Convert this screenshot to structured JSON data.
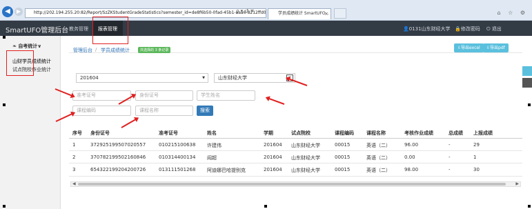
{
  "browser": {
    "url": "http://202.194.255.20:82/Report/SzZKStudentGradeStatistics?semester_id=de8f6b50-0fad-45b1-aaa6-8212ffd0(",
    "url_icons": "ρ ▾ ↺ ✕",
    "tab_title": "学员成绩统计 SmartUFO...",
    "tab_close": "×",
    "window_icons": "⌂ ☆ ⚙"
  },
  "header": {
    "brand": "SmartUFO管理后台",
    "nav": [
      "教务管理",
      "报表管理"
    ],
    "user": "0131山东财经大学",
    "change_password": "修改密码",
    "logout": "退出"
  },
  "sidebar": {
    "group": "自考统计",
    "items": [
      "山财学员成绩统计",
      "试点院校作业统计"
    ]
  },
  "breadcrumb": {
    "items": [
      "管理后台",
      "学员成绩统计"
    ],
    "separator": "/",
    "badge": "共选择的 3 条记录"
  },
  "toolbar": {
    "export_excel": "导出excel",
    "export_pdf": "导出pdf"
  },
  "filters": {
    "semester": "201604",
    "school": "山东财经大学",
    "exam_no_placeholder": "准考证号",
    "id_no_placeholder": "身份证号",
    "name_placeholder": "学生姓名",
    "course_code_placeholder": "课程编码",
    "course_name_placeholder": "课程名称",
    "search_label": "搜索"
  },
  "table": {
    "headers": [
      "序号",
      "身份证号",
      "准考证号",
      "姓名",
      "学期",
      "试点院校",
      "课程编码",
      "课程名称",
      "考核作业成绩",
      "总成绩",
      "上报成绩"
    ],
    "rows": [
      [
        "1",
        "372925199507020557",
        "010215100638",
        "许建伟",
        "201604",
        "山东财经大学",
        "00015",
        "英语（二）",
        "96.00",
        "-",
        "29"
      ],
      [
        "2",
        "370782199502160846",
        "010314400134",
        "阎超",
        "201604",
        "山东财经大学",
        "00015",
        "英语（二）",
        "0.00",
        "-",
        "1"
      ],
      [
        "3",
        "654322199204200726",
        "013111501268",
        "阿迪娜巴哈提别克",
        "201604",
        "山东财经大学",
        "00015",
        "英语（二）",
        "98.00",
        "-",
        "30"
      ]
    ]
  },
  "colors": {
    "header_bg": "#333b45",
    "accent": "#337ab7",
    "export_btn": "#5bc0de",
    "annotation": "#e02020"
  }
}
